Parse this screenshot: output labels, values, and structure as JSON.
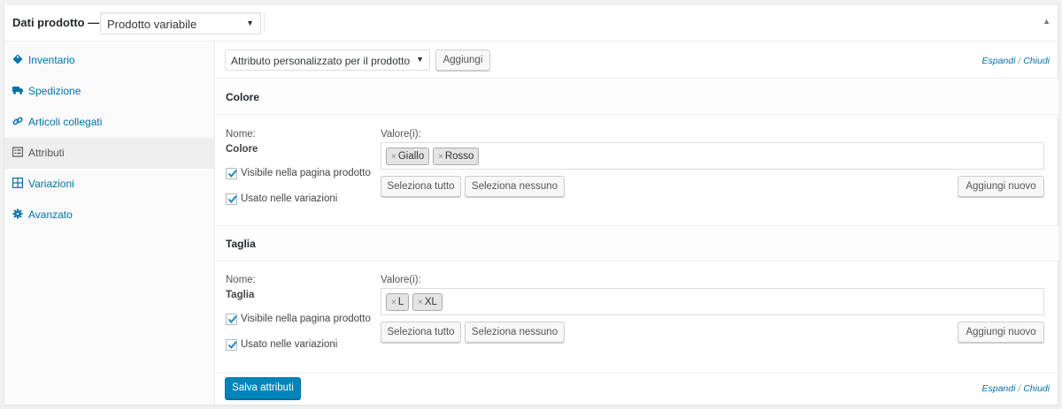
{
  "header": {
    "title": "Dati prodotto —",
    "product_type": "Prodotto variabile"
  },
  "sidebar": {
    "items": [
      {
        "label": "Inventario",
        "icon": "tag-icon"
      },
      {
        "label": "Spedizione",
        "icon": "truck-icon"
      },
      {
        "label": "Articoli collegati",
        "icon": "link-icon"
      },
      {
        "label": "Attributi",
        "icon": "list-icon",
        "active": true
      },
      {
        "label": "Variazioni",
        "icon": "grid-icon"
      },
      {
        "label": "Avanzato",
        "icon": "gear-icon"
      }
    ]
  },
  "toolbar": {
    "attribute_select": "Attributo personalizzato per il prodotto",
    "add_label": "Aggiungi",
    "expand": "Espandi",
    "separator": "/",
    "collapse": "Chiudi"
  },
  "attributes": [
    {
      "title": "Colore",
      "name_label": "Nome:",
      "name": "Colore",
      "values_label": "Valore(i):",
      "values": [
        "Giallo",
        "Rosso"
      ],
      "visible_label": "Visibile nella pagina prodotto",
      "variations_label": "Usato nelle variazioni",
      "select_all": "Seleziona tutto",
      "select_none": "Seleziona nessuno",
      "add_new": "Aggiungi nuovo"
    },
    {
      "title": "Taglia",
      "name_label": "Nome:",
      "name": "Taglia",
      "values_label": "Valore(i):",
      "values": [
        "L",
        "XL"
      ],
      "visible_label": "Visibile nella pagina prodotto",
      "variations_label": "Usato nelle variazioni",
      "select_all": "Seleziona tutto",
      "select_none": "Seleziona nessuno",
      "add_new": "Aggiungi nuovo"
    }
  ],
  "tag_remove": "×",
  "footer": {
    "save_label": "Salva attributi"
  },
  "colors": {
    "link": "#0073aa",
    "primary_button": "#0085ba"
  }
}
